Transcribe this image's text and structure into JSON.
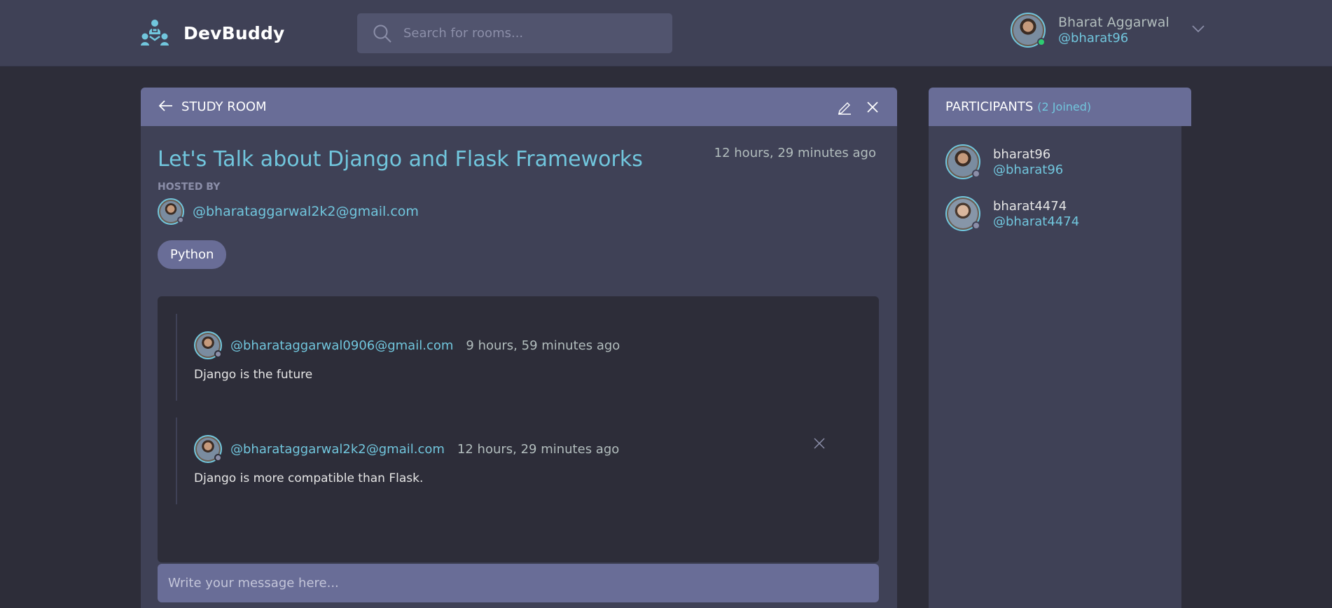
{
  "header": {
    "app_name": "DevBuddy",
    "search": {
      "placeholder": "Search for rooms..."
    },
    "user": {
      "name": "Bharat Aggarwal",
      "handle": "@bharat96"
    }
  },
  "room": {
    "section_label": "STUDY ROOM",
    "title": "Let's Talk about Django and Flask Frameworks",
    "time": "12 hours, 29 minutes ago",
    "hosted_by_label": "HOSTED BY",
    "host_email": "@bharataggarwal2k2@gmail.com",
    "topic": "Python",
    "messages": [
      {
        "email": "@bharataggarwal0906@gmail.com",
        "time": "9 hours, 59 minutes ago",
        "text": "Django is the future"
      },
      {
        "email": "@bharataggarwal2k2@gmail.com",
        "time": "12 hours, 29 minutes ago",
        "text": "Django is more compatible than Flask."
      }
    ],
    "composer": {
      "placeholder": "Write your message here..."
    }
  },
  "participants": {
    "label": "PARTICIPANTS",
    "count": "(2 Joined)",
    "list": [
      {
        "name": "bharat96",
        "handle": "@bharat96"
      },
      {
        "name": "bharat4474",
        "handle": "@bharat4474"
      }
    ]
  },
  "colors": {
    "accent": "#71c6dd",
    "panel": "#3f4156",
    "panel_header": "#696d97",
    "background": "#2d2d39",
    "online": "#2ecc71"
  }
}
